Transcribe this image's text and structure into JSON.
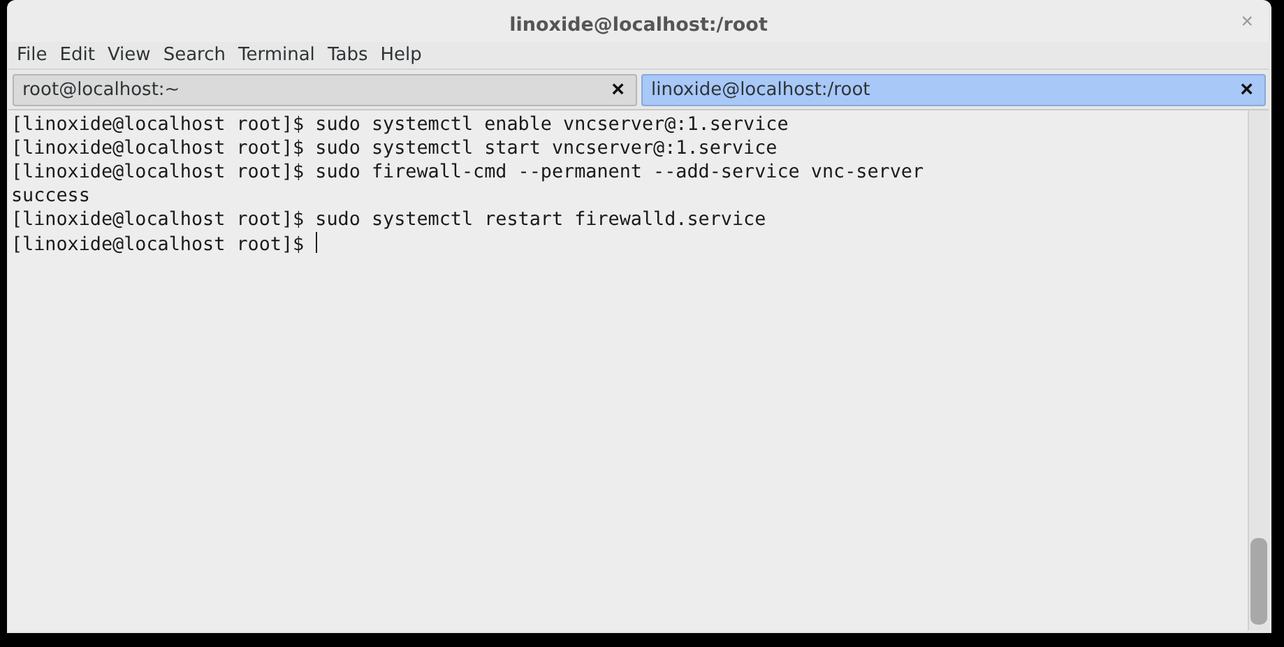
{
  "window": {
    "title": "linoxide@localhost:/root",
    "close": "×"
  },
  "menu": [
    "File",
    "Edit",
    "View",
    "Search",
    "Terminal",
    "Tabs",
    "Help"
  ],
  "tabs": [
    {
      "label": "root@localhost:~",
      "close": "×",
      "selected": false
    },
    {
      "label": "linoxide@localhost:/root",
      "close": "×",
      "selected": true
    }
  ],
  "terminal": {
    "lines": [
      "[linoxide@localhost root]$ sudo systemctl enable vncserver@:1.service",
      "[linoxide@localhost root]$ sudo systemctl start vncserver@:1.service",
      "[linoxide@localhost root]$ sudo firewall-cmd --permanent --add-service vnc-server",
      "success",
      "[linoxide@localhost root]$ sudo systemctl restart firewalld.service",
      "[linoxide@localhost root]$ "
    ],
    "cursor": true
  }
}
